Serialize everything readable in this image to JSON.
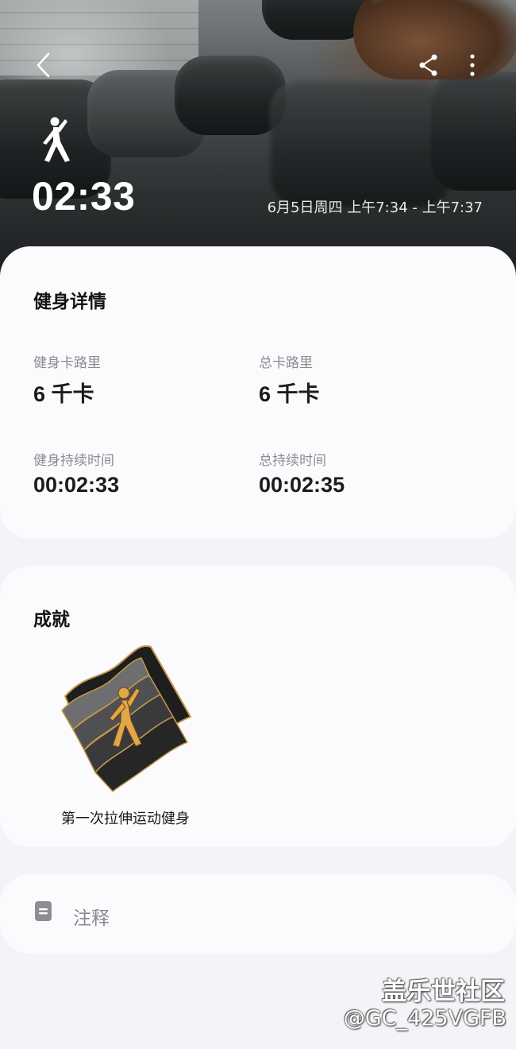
{
  "header": {
    "duration": "02:33",
    "time_range": "6月5日周四 上午7:34 - 上午7:37",
    "icons": {
      "back": "chevron-left-icon",
      "share": "share-icon",
      "more": "more-vertical-icon",
      "workout": "stretching-person-icon"
    }
  },
  "details": {
    "title": "健身详情",
    "stats": [
      {
        "label": "健身卡路里",
        "value": "6 千卡"
      },
      {
        "label": "总卡路里",
        "value": "6 千卡"
      },
      {
        "label": "健身持续时间",
        "value": "00:02:33"
      },
      {
        "label": "总持续时间",
        "value": "00:02:35"
      }
    ]
  },
  "achievements": {
    "title": "成就",
    "badge_name": "第一次拉伸运动健身",
    "badge_icon": "stretching-achievement-badge"
  },
  "notes": {
    "label": "注释",
    "icon": "note-icon"
  },
  "watermark": {
    "site": "盖乐世社区",
    "user": "@GC_425VGFB"
  },
  "colors": {
    "card_bg": "#fbfbfe",
    "page_bg": "#f4f4f8",
    "label_gray": "#8c8c90",
    "badge_gold": "#d9a441"
  }
}
